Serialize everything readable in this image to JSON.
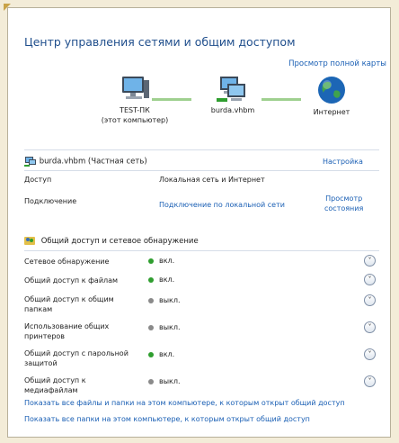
{
  "title": "Центр управления сетями и общим доступом",
  "full_map_link": "Просмотр полной карты",
  "map": {
    "computer": {
      "line1": "TEST-ПК",
      "line2": "(этот компьютер)"
    },
    "network": {
      "label": "burda.vhbm"
    },
    "internet": {
      "label": "Интернет"
    }
  },
  "network_section": {
    "name": "burda.vhbm (Частная сеть)",
    "customize_link": "Настройка",
    "rows": [
      {
        "label": "Доступ",
        "value": "Локальная сеть и Интернет"
      },
      {
        "label": "Подключение",
        "value": "Подключение по локальной сети"
      }
    ],
    "view_status_link_line1": "Просмотр",
    "view_status_link_line2": "состояния"
  },
  "sharing_section": {
    "heading": "Общий доступ и сетевое обнаружение",
    "items": [
      {
        "name": "Сетевое обнаружение",
        "state": "вкл.",
        "on": true
      },
      {
        "name": "Общий доступ к файлам",
        "state": "вкл.",
        "on": true
      },
      {
        "name": "Общий доступ к общим папкам",
        "state": "выкл.",
        "on": false
      },
      {
        "name": "Использование общих принтеров",
        "state": "выкл.",
        "on": false
      },
      {
        "name": "Общий доступ с парольной защитой",
        "state": "вкл.",
        "on": true
      },
      {
        "name": "Общий доступ к медиафайлам",
        "state": "выкл.",
        "on": false
      }
    ]
  },
  "links": {
    "show_all_files": "Показать все файлы и папки на этом компьютере, к которым открыт общий доступ",
    "show_all_folders": "Показать все папки на этом компьютере, к которым открыт общий доступ"
  },
  "colors": {
    "on": "#2f9e2f",
    "off": "#8a8a8a",
    "link": "#1a5fb4"
  }
}
